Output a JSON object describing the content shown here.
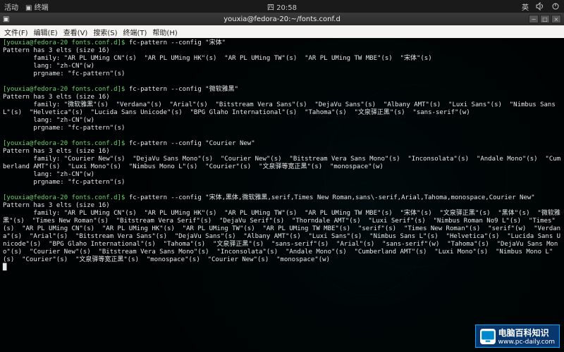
{
  "topbar": {
    "activities": "活动",
    "app": "终端",
    "clock": "四 20:58",
    "lang": "英",
    "sound_icon": "sound",
    "power_icon": "power"
  },
  "titlebar": {
    "title": "youxia@fedora-20:~/fonts.conf.d",
    "min": "−",
    "max": "□",
    "close": "×"
  },
  "menubar": {
    "file": "文件(F)",
    "edit": "编辑(E)",
    "view": "查看(V)",
    "search": "搜索(S)",
    "terminal": "终端(T)",
    "help": "帮助(H)"
  },
  "prompt": "[youxia@fedora-20 fonts.conf.d]$",
  "commands": {
    "c1": "fc-pattern --config \"宋体\"",
    "c2": "fc-pattern --config \"微软雅黑\"",
    "c3": "fc-pattern --config \"Courier New\"",
    "c4": "fc-pattern --config \"宋体,黑体,微软雅黑,serif,Times New Roman,sans\\-serif,Arial,Tahoma,monospace,Courier New\""
  },
  "out": {
    "header": "Pattern has 3 elts (size 16)",
    "lang": "        lang: \"zh-CN\"(w)",
    "prg": "        prgname: \"fc-pattern\"(s)",
    "f1": "        family: \"AR PL UMing CN\"(s)  \"AR PL UMing HK\"(s)  \"AR PL UMing TW\"(s)  \"AR PL UMing TW MBE\"(s)  \"宋体\"(s)",
    "f2": "        family: \"微软雅黑\"(s)  \"Verdana\"(s)  \"Arial\"(s)  \"Bitstream Vera Sans\"(s)  \"DejaVu Sans\"(s)  \"Albany AMT\"(s)  \"Luxi Sans\"(s)  \"Nimbus Sans L\"(s)  \"Helvetica\"(s)  \"Lucida Sans Unicode\"(s)  \"BPG Glaho International\"(s)  \"Tahoma\"(s)  \"文泉驿正黑\"(s)  \"sans-serif\"(w)",
    "f3": "        family: \"Courier New\"(s)  \"DejaVu Sans Mono\"(s)  \"Courier New\"(s)  \"Bitstream Vera Sans Mono\"(s)  \"Inconsolata\"(s)  \"Andale Mono\"(s)  \"Cumberland AMT\"(s)  \"Luxi Mono\"(s)  \"Nimbus Mono L\"(s)  \"Courier\"(s)  \"文泉驿等宽正黑\"(s)  \"monospace\"(w)",
    "f4": "        family: \"AR PL UMing CN\"(s)  \"AR PL UMing HK\"(s)  \"AR PL UMing TW\"(s)  \"AR PL UMing TW MBE\"(s)  \"宋体\"(s)  \"文泉驿正黑\"(s)  \"黑体\"(s)  \"微软雅黑\"(s)  \"Times New Roman\"(s)  \"Bitstream Vera Serif\"(s)  \"DejaVu Serif\"(s)  \"Thorndale AMT\"(s)  \"Luxi Serif\"(s)  \"Nimbus Roman No9 L\"(s)  \"Times\"(s)  \"AR PL UMing CN\"(s)  \"AR PL UMing HK\"(s)  \"AR PL UMing TW\"(s)  \"AR PL UMing TW MBE\"(s)  \"serif\"(s)  \"Times New Roman\"(s)  \"serif\"(w)  \"Verdana\"(s)  \"Arial\"(s)  \"Bitstream Vera Sans\"(s)  \"DejaVu Sans\"(s)  \"Albany AMT\"(s)  \"Luxi Sans\"(s)  \"Nimbus Sans L\"(s)  \"Helvetica\"(s)  \"Lucida Sans Unicode\"(s)  \"BPG Glaho International\"(s)  \"Tahoma\"(s)  \"文泉驿正黑\"(s)  \"sans-serif\"(s)  \"Arial\"(s)  \"sans-serif\"(w)  \"Tahoma\"(s)  \"DejaVu Sans Mono\"(s)  \"Courier New\"(s)  \"Bitstream Vera Sans Mono\"(s)  \"Inconsolata\"(s)  \"Andale Mono\"(s)  \"Cumberland AMT\"(s)  \"Luxi Mono\"(s)  \"Nimbus Mono L\"(s)  \"Courier\"(s)  \"文泉驿等宽正黑\"(s)  \"monospace\"(s)  \"Courier New\"(s)  \"monospace\"(w)"
  },
  "watermark": {
    "text": "电脑百科知识",
    "url": "www.pc-daily.com"
  }
}
